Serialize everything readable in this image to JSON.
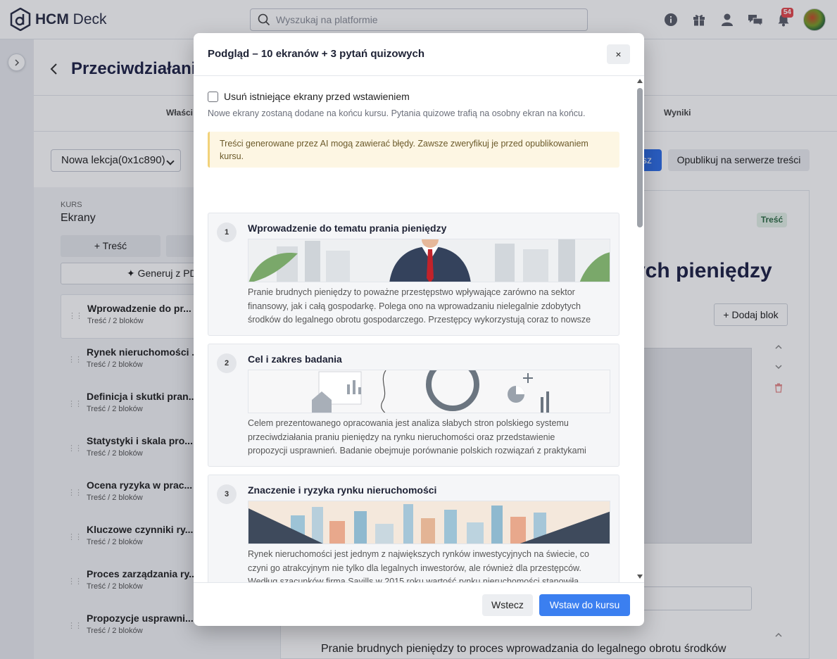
{
  "app": {
    "logo_bold": "HCM",
    "logo_rest": " Deck",
    "search_placeholder": "Wyszukaj na platformie",
    "notification_count": "54"
  },
  "background": {
    "page_title": "Przeciwdziałani",
    "tabs": [
      "Właści",
      "Wyniki"
    ],
    "lesson_select": "Nowa lekcja(0x1c890)",
    "save_label": "sz",
    "publish_label": "Opublikuj na serwerze treści",
    "course_label": "KURS",
    "screens_label": "Ekrany",
    "add_content_label": "+ Treść",
    "generate_label": "✦ Generuj z PD",
    "screens": [
      {
        "title": "Wprowadzenie do pr...",
        "sub": "Treść / 2 bloków"
      },
      {
        "title": "Rynek nieruchomości ...",
        "sub": "Treść / 2 bloków"
      },
      {
        "title": "Definicja i skutki pran...",
        "sub": "Treść / 2 bloków"
      },
      {
        "title": "Statystyki i skala pro...",
        "sub": "Treść / 2 bloków"
      },
      {
        "title": "Ocena ryzyka w prac...",
        "sub": "Treść / 2 bloków"
      },
      {
        "title": "Kluczowe czynniki ry...",
        "sub": "Treść / 2 bloków"
      },
      {
        "title": "Proces zarządzania ry...",
        "sub": "Treść / 2 bloków"
      },
      {
        "title": "Propozycje usprawni...",
        "sub": "Treść / 2 bloków"
      }
    ],
    "badge_label": "Treść",
    "heading_fragment": "ych pieniędzy",
    "add_block_label": "+ Dodaj blok",
    "bottom_text": "Pranie brudnych pieniędzy to proces wprowadzania do legalnego obrotu środków"
  },
  "modal": {
    "title": "Podgląd – 10 ekranów + 3 pytań quizowych",
    "close_label": "×",
    "checkbox_label": "Usuń istniejące ekrany przed wstawieniem",
    "hint": "Nowe ekrany zostaną dodane na końcu kursu. Pytania quizowe trafią na osobny ekran na końcu.",
    "warning": "Treści generowane przez AI mogą zawierać błędy. Zawsze zweryfikuj je przed opublikowaniem kursu.",
    "cards": [
      {
        "num": "1",
        "title": "Wprowadzenie do tematu prania pieniędzy",
        "lines": [
          "Pranie brudnych pieniędzy to poważne przestępstwo wpływające zarówno na sektor",
          "finansowy, jak i całą gospodarkę. Polega ono na wprowadzaniu nielegalnie zdobytych",
          "środków do legalnego obrotu gospodarczego. Przestępcy wykorzystują coraz to nowsze"
        ]
      },
      {
        "num": "2",
        "title": "Cel i zakres badania",
        "lines": [
          "Celem prezentowanego opracowania jest analiza słabych stron polskiego systemu",
          "przeciwdziałania praniu pieniędzy na rynku nieruchomości oraz przedstawienie",
          "propozycji usprawnień. Badanie obejmuje porównanie polskich rozwiązań z praktykami"
        ]
      },
      {
        "num": "3",
        "title": "Znaczenie i ryzyka rynku nieruchomości",
        "lines": [
          "Rynek nieruchomości jest jednym z największych rynków inwestycyjnych na świecie, co",
          "czyni go atrakcyjnym nie tylko dla legalnych inwestorów, ale również dla przestępców.",
          "Według szacunków firma Savills w 2015 roku wartość rynku nieruchomości stanowiła"
        ]
      }
    ],
    "back_label": "Wstecz",
    "insert_label": "Wstaw do kursu"
  },
  "colors": {
    "primary": "#3b7ff0",
    "warning_bg": "#fdf6e3",
    "badge_red": "#e5484d"
  }
}
